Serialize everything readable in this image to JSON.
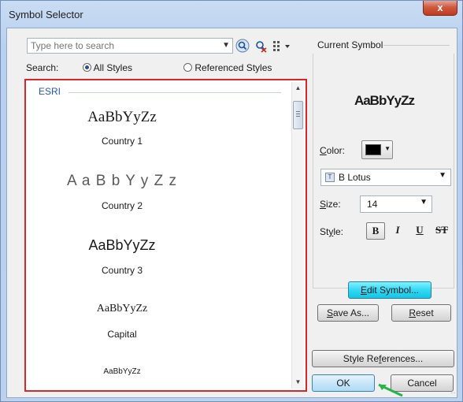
{
  "window": {
    "title": "Symbol Selector",
    "close_glyph": "x"
  },
  "search": {
    "placeholder": "Type here to search",
    "label": "Search:",
    "all_styles": "All Styles",
    "referenced_styles": "Referenced Styles",
    "selected": "All Styles"
  },
  "icons": [
    "search-icon",
    "clear-search-icon",
    "view-options-icon",
    "chevron-down-icon"
  ],
  "gallery": {
    "group": "ESRI",
    "items": [
      {
        "sample": "AaBbYyZz",
        "caption": "Country 1"
      },
      {
        "sample": "A a B b Y y Z z",
        "caption": "Country 2"
      },
      {
        "sample": "AaBbYyZz",
        "caption": "Country 3"
      },
      {
        "sample": "AaBbYyZz",
        "caption": "Capital"
      },
      {
        "sample": "AaBbYyZz",
        "caption": ""
      }
    ]
  },
  "current_symbol": {
    "title": "Current Symbol",
    "preview": "AaBbYyZz",
    "color_label": "Color:",
    "color_value": "#000000",
    "font": "B Lotus",
    "size_label": "Size:",
    "size": "14",
    "style_label": "Style:",
    "style_buttons": [
      "B",
      "I",
      "U",
      "S"
    ]
  },
  "buttons": {
    "edit_symbol": "Edit Symbol...",
    "save_as": "Save As...",
    "reset": "Reset",
    "style_references": "Style References...",
    "ok": "OK",
    "cancel": "Cancel"
  },
  "colors": {
    "highlight_border": "#d9262b",
    "edit_button": "#33d8f3",
    "group_label": "#2b57a6"
  }
}
